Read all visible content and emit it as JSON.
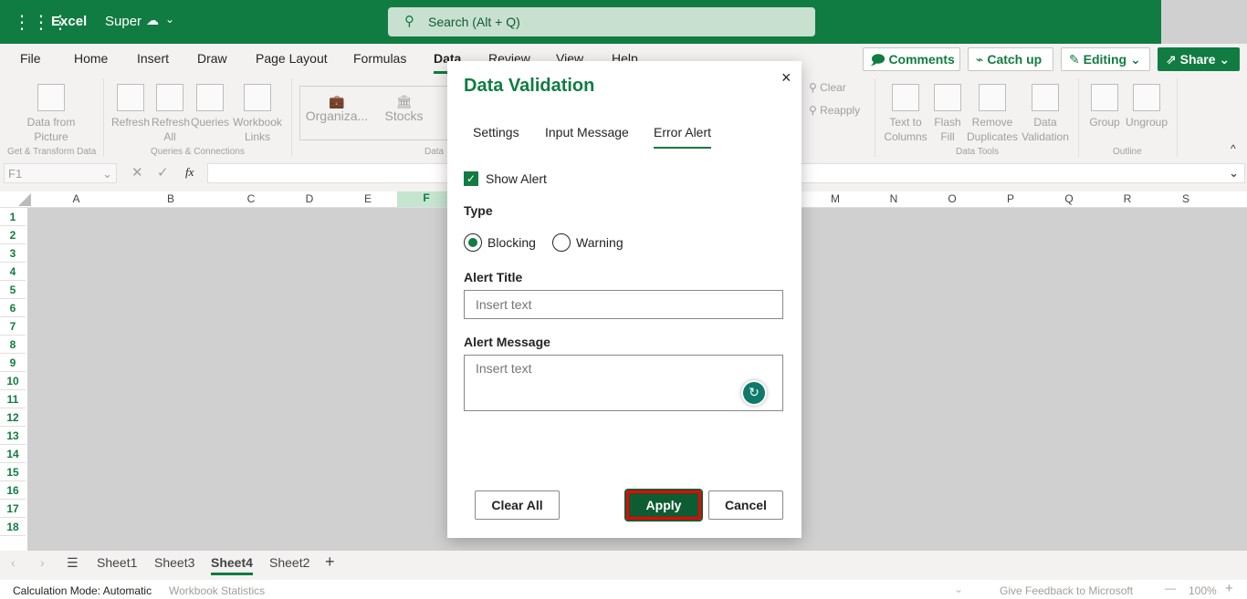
{
  "app": {
    "name": "Excel",
    "doc_name": "Super",
    "search_placeholder": "Search (Alt + Q)",
    "accent": "#107c41"
  },
  "menu_tabs": [
    "File",
    "Home",
    "Insert",
    "Draw",
    "Page Layout",
    "Formulas",
    "Data",
    "Review",
    "View",
    "Help"
  ],
  "active_tab": "Data",
  "actions": {
    "comments": "Comments",
    "catch_up": "Catch up",
    "editing": "Editing",
    "share": "Share"
  },
  "ribbon": {
    "data_from_picture": "Data from Picture",
    "refresh": "Refresh",
    "refresh_all": "Refresh All",
    "queries": "Queries",
    "workbook_links": "Workbook Links",
    "organization": "Organiza...",
    "stocks": "Stocks",
    "clear": "Clear",
    "reapply": "Reapply",
    "text_to_columns": "Text to Columns",
    "flash_fill": "Flash Fill",
    "remove_duplicates": "Remove Duplicates",
    "data_validation": "Data Validation",
    "group": "Group",
    "ungroup": "Ungroup",
    "groups": {
      "get_transform": "Get & Transform Data",
      "queries_connections": "Queries & Connections",
      "data_types": "Data",
      "data_tools": "Data Tools",
      "outline": "Outline"
    }
  },
  "formula_bar": {
    "name_box": "F1",
    "fx": "fx",
    "value": ""
  },
  "columns": [
    "A",
    "B",
    "C",
    "D",
    "E",
    "F",
    "M",
    "N",
    "O",
    "P",
    "Q",
    "R",
    "S"
  ],
  "rows": [
    "1",
    "2",
    "3",
    "4",
    "5",
    "6",
    "7",
    "8",
    "9",
    "10",
    "11",
    "12",
    "13",
    "14",
    "15",
    "16",
    "17",
    "18"
  ],
  "dialog": {
    "title": "Data Validation",
    "tabs": [
      "Settings",
      "Input Message",
      "Error Alert"
    ],
    "active_tab": "Error Alert",
    "show_alert_label": "Show Alert",
    "show_alert_checked": true,
    "type_label": "Type",
    "type_options": [
      "Blocking",
      "Warning"
    ],
    "type_selected": "Blocking",
    "alert_title_label": "Alert Title",
    "alert_title_placeholder": "Insert text",
    "alert_title_value": "",
    "alert_message_label": "Alert Message",
    "alert_message_placeholder": "Insert text",
    "alert_message_value": "",
    "clear_all": "Clear All",
    "apply": "Apply",
    "cancel": "Cancel",
    "close": "×"
  },
  "sheets": [
    "Sheet1",
    "Sheet3",
    "Sheet4",
    "Sheet2"
  ],
  "active_sheet": "Sheet4",
  "status": {
    "calc_mode": "Calculation Mode: Automatic",
    "workbook_stats": "Workbook Statistics",
    "feedback": "Give Feedback to Microsoft",
    "zoom": "100%"
  }
}
